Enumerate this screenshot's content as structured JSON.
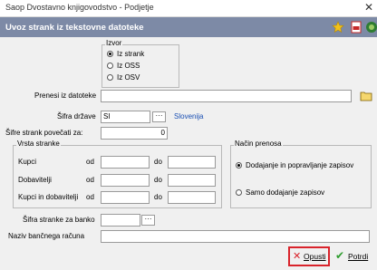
{
  "window_title": "Saop Dvostavno knjigovodstvo - Podjetje",
  "close_glyph": "✕",
  "dialog_title": "Uvoz strank iz tekstovne datoteke",
  "header_icons": [
    "star-icon",
    "pdf-icon",
    "help-icon"
  ],
  "izvor": {
    "legend": "Izvor",
    "options": [
      "Iz strank",
      "Iz OSS",
      "Iz OSV"
    ],
    "selected": "Iz strank"
  },
  "prenesi": {
    "label": "Prenesi iz datoteke",
    "value": ""
  },
  "sifra_drzave": {
    "label": "Šifra države",
    "value": "SI",
    "country_name": "Slovenija"
  },
  "povecati": {
    "label": "Šifre strank povečati za:",
    "value": "0"
  },
  "vrsta": {
    "legend": "Vrsta stranke",
    "from_label": "od",
    "to_label": "do",
    "rows": [
      {
        "label": "Kupci",
        "from": "",
        "to": ""
      },
      {
        "label": "Dobavitelji",
        "from": "",
        "to": ""
      },
      {
        "label": "Kupci in dobavitelji",
        "from": "",
        "to": ""
      }
    ]
  },
  "nacin": {
    "legend": "Način prenosa",
    "options": [
      "Dodajanje in popravljanje zapisov",
      "Samo dodajanje zapisov"
    ],
    "selected": "Dodajanje in popravljanje zapisov"
  },
  "sifra_banka": {
    "label": "Šifra stranke za banko",
    "value": ""
  },
  "naziv_racuna": {
    "label": "Naziv bančnega računa",
    "value": ""
  },
  "buttons": {
    "cancel": "Opusti",
    "confirm": "Potrdi"
  },
  "colors": {
    "header": "#7d8aa6",
    "cancel_highlight": "#d9232b",
    "link_blue": "#1a4fb3"
  }
}
